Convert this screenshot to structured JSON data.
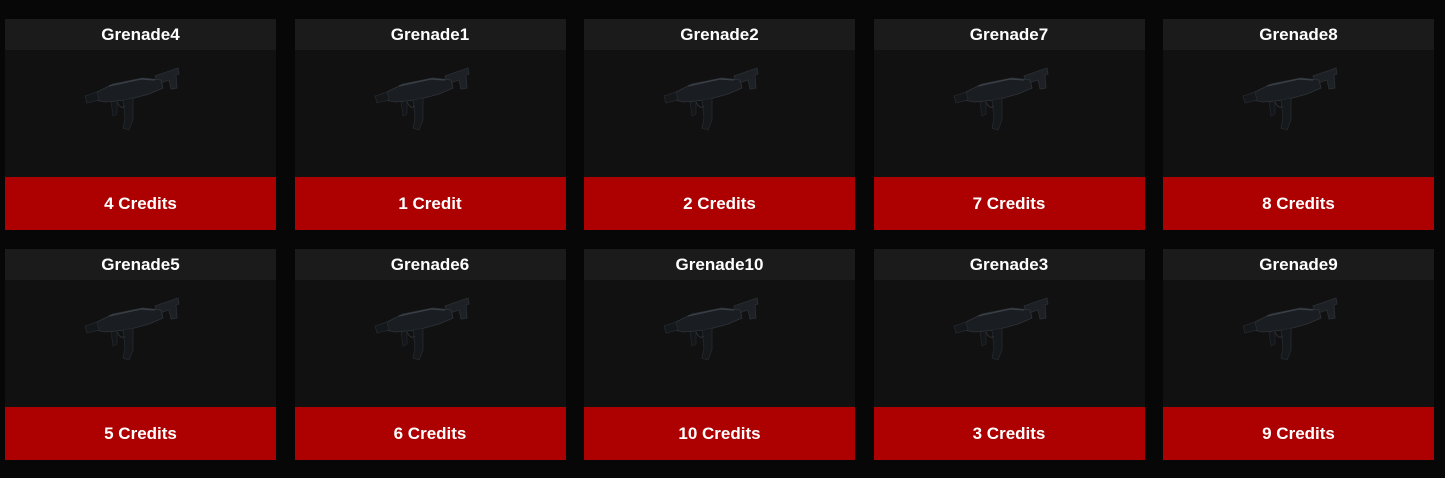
{
  "theme": {
    "background": "#070707",
    "card_background": "#111111",
    "title_background": "#1b1b1b",
    "accent": "#ad0000",
    "text": "#ffffff"
  },
  "items": [
    {
      "name": "Grenade4",
      "price_label": "4 Credits",
      "icon": "smg-icon"
    },
    {
      "name": "Grenade1",
      "price_label": "1 Credit",
      "icon": "smg-icon"
    },
    {
      "name": "Grenade2",
      "price_label": "2 Credits",
      "icon": "smg-icon"
    },
    {
      "name": "Grenade7",
      "price_label": "7 Credits",
      "icon": "smg-icon"
    },
    {
      "name": "Grenade8",
      "price_label": "8 Credits",
      "icon": "smg-icon"
    },
    {
      "name": "Grenade5",
      "price_label": "5 Credits",
      "icon": "smg-icon"
    },
    {
      "name": "Grenade6",
      "price_label": "6 Credits",
      "icon": "smg-icon"
    },
    {
      "name": "Grenade10",
      "price_label": "10 Credits",
      "icon": "smg-icon"
    },
    {
      "name": "Grenade3",
      "price_label": "3 Credits",
      "icon": "smg-icon"
    },
    {
      "name": "Grenade9",
      "price_label": "9 Credits",
      "icon": "smg-icon"
    }
  ]
}
